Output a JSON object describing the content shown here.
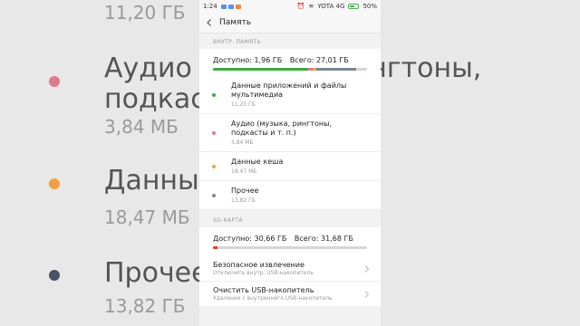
{
  "status_bar": {
    "time": "1:24",
    "carrier": "YOTA 4G",
    "battery": "50%"
  },
  "header": {
    "title": "Память"
  },
  "internal": {
    "section_label": "ВНУТР. ПАМЯТЬ",
    "available": "Доступно: 1,96 ГБ",
    "total": "Всего: 27,01 ГБ",
    "usage_segments": [
      {
        "name": "apps",
        "fraction": 0.62,
        "color": "#3fa83f"
      },
      {
        "name": "audio",
        "fraction": 0.03,
        "color": "#e07a8f"
      },
      {
        "name": "cache",
        "fraction": 0.02,
        "color": "#f0a040"
      },
      {
        "name": "other",
        "fraction": 0.26,
        "color": "#7a8593"
      }
    ],
    "items": [
      {
        "label": "Данные приложений и файлы мультимедиа",
        "size": "11,20 ГБ",
        "color": "#3fa83f"
      },
      {
        "label": "Аудио (музыка, рингтоны, подкасты и т. п.)",
        "size": "3,84 МБ",
        "color": "#e07a8f"
      },
      {
        "label": "Данные кеша",
        "size": "18,47 МБ",
        "color": "#f0a040"
      },
      {
        "label": "Прочее",
        "size": "13,82 ГБ",
        "color": "#7a8593"
      }
    ]
  },
  "sd": {
    "section_label": "SD-КАРТА",
    "available": "Доступно: 30,66 ГБ",
    "total": "Всего: 31,68 ГБ",
    "usage_fraction": 0.03,
    "usage_color": "#e53935",
    "actions": [
      {
        "label": "Безопасное извлечение",
        "desc": "Отключить внутр. USB-накопитель"
      },
      {
        "label": "Очистить USB-накопитель",
        "desc": "Удаление с внутреннего USB-накопитель"
      }
    ]
  },
  "background": {
    "rows": [
      {
        "text": "11,20 ГБ"
      },
      {
        "text": "Аудио (музыка, рингтоны,"
      },
      {
        "text": "подкасты и т. п.)"
      },
      {
        "text": "3,84 МБ"
      },
      {
        "text": "Данные кеша"
      },
      {
        "text": "18,47 МБ"
      },
      {
        "text": "Прочее"
      },
      {
        "text": "13,82 ГБ"
      }
    ]
  }
}
